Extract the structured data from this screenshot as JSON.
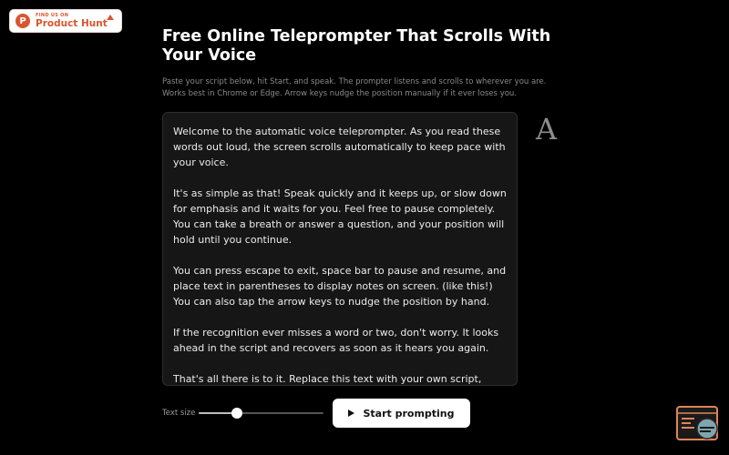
{
  "badge": {
    "small_text": "FIND US ON",
    "big_text": "Product Hunt",
    "logo_letter": "P",
    "icon": "product-hunt-icon"
  },
  "header": {
    "title": "Free Online Teleprompter That Scrolls With Your Voice",
    "subtitle": "Paste your script below, hit Start, and speak. The prompter listens and scrolls to wherever you are. Works best in Chrome or Edge. Arrow keys nudge the position manually if it ever loses you."
  },
  "script": {
    "paragraphs": [
      "Welcome to the automatic voice teleprompter. As you read these words out loud, the screen scrolls automatically to keep pace with your voice.",
      "It's as simple as that! Speak quickly and it keeps up, or slow down for emphasis and it waits for you. Feel free to pause completely. You can take a breath or answer a question, and your position will hold until you continue.",
      "You can press escape to exit, space bar to pause and resume, and place text in parentheses to display notes on screen. (like this!) You can also tap the arrow keys to nudge the position by hand.",
      "If the recognition ever misses a word or two, don't worry. It looks ahead in the script and recovers as soon as it hears you again.",
      "That's all there is to it. Replace this text with your own script, press"
    ]
  },
  "font_icon": {
    "glyph": "A",
    "icon": "font-icon"
  },
  "controls": {
    "text_size_label": "Text size",
    "text_size_fraction": 0.31,
    "start_label": "Start prompting",
    "start_icon": "play-icon"
  },
  "colors": {
    "background": "#000000",
    "accent_brand": "#da552f",
    "panel": "#161616",
    "button": "#ffffff"
  },
  "corner_widget": {
    "icon": "chat-support-icon"
  }
}
